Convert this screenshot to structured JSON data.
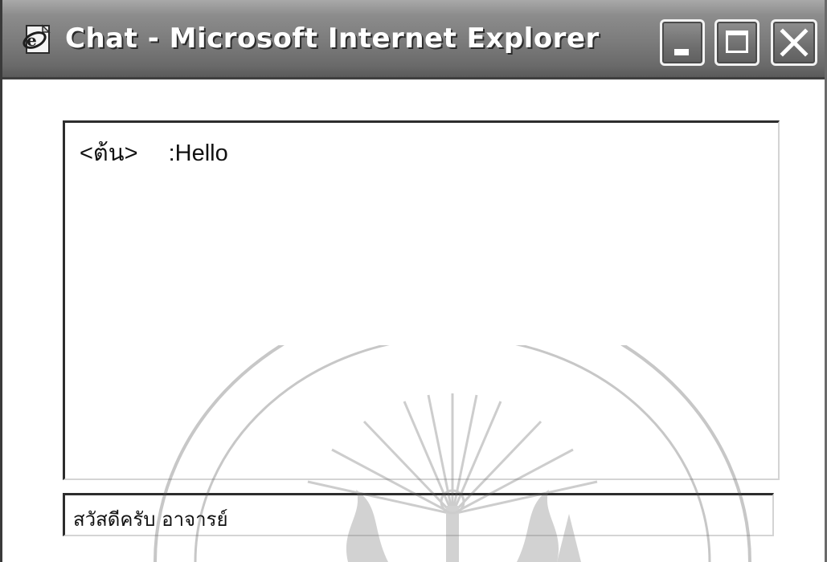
{
  "window": {
    "title": "Chat - Microsoft Internet Explorer",
    "icon": "ie-page-icon",
    "controls": [
      "minimize",
      "maximize",
      "close"
    ]
  },
  "chat": {
    "messages": [
      {
        "user": "<ต้น>",
        "text": ":Hello"
      }
    ]
  },
  "input": {
    "value": "สวัสดีครับ อาจารย์"
  },
  "colors": {
    "titlebar": "#7b7b7b",
    "title_text": "#ffffff",
    "background": "#ffffff"
  }
}
